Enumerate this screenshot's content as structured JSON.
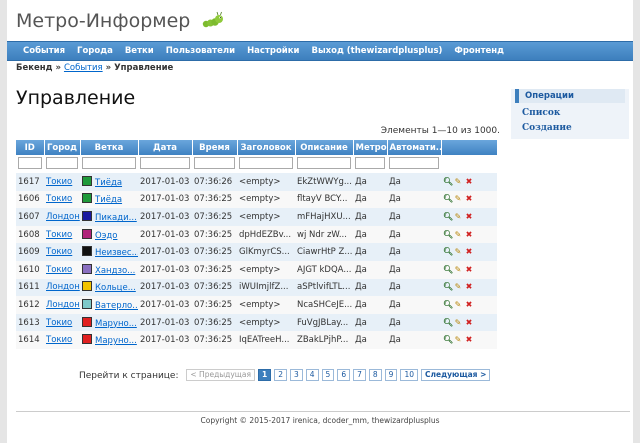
{
  "site": {
    "title": "Метро-Информер"
  },
  "menu": [
    "События",
    "Города",
    "Ветки",
    "Пользователи",
    "Настройки",
    "Выход (thewizardplusplus)",
    "Фронтенд"
  ],
  "breadcrumb": {
    "root": "Бекенд",
    "sep1": "»",
    "link": "События",
    "sep2": "»",
    "current": "Управление"
  },
  "page": {
    "heading": "Управление",
    "summary": "Элементы 1—10 из 1000."
  },
  "operations": {
    "title": "Операции",
    "list": "Список",
    "create": "Создание"
  },
  "table": {
    "headers": [
      "ID",
      "Город",
      "Ветка",
      "Дата",
      "Время",
      "Заголовок",
      "Описание",
      "Метро",
      "Автомати..."
    ],
    "rows": [
      {
        "id": "1617",
        "city": "Токио",
        "line": "Тиёда",
        "color": "#1f9a3a",
        "date": "2017-01-03",
        "time": "07:36:26",
        "title": "<empty>",
        "desc": "EkZtWWYg...",
        "metro": "Да",
        "auto": "Да"
      },
      {
        "id": "1606",
        "city": "Токио",
        "line": "Тиёда",
        "color": "#1f9a3a",
        "date": "2017-01-03",
        "time": "07:36:25",
        "title": "<empty>",
        "desc": "fltayV BCY...",
        "metro": "Да",
        "auto": "Да"
      },
      {
        "id": "1607",
        "city": "Лондон",
        "line": "Пикади...",
        "color": "#1a1aa0",
        "date": "2017-01-03",
        "time": "07:36:25",
        "title": "<empty>",
        "desc": "mFHajHXU...",
        "metro": "Да",
        "auto": "Да"
      },
      {
        "id": "1608",
        "city": "Токио",
        "line": "Оэдо",
        "color": "#b0237a",
        "date": "2017-01-03",
        "time": "07:36:25",
        "title": "dpHdEZBv...",
        "desc": "wj Ndr zW...",
        "metro": "Да",
        "auto": "Да"
      },
      {
        "id": "1609",
        "city": "Токио",
        "line": "Неизвес...",
        "color": "#111111",
        "date": "2017-01-03",
        "time": "07:36:25",
        "title": "GlKmyrCS...",
        "desc": "CiawrHtP Z...",
        "metro": "Да",
        "auto": "Да"
      },
      {
        "id": "1610",
        "city": "Токио",
        "line": "Хандзо...",
        "color": "#8a6fc0",
        "date": "2017-01-03",
        "time": "07:36:25",
        "title": "<empty>",
        "desc": "AJGT kDQA...",
        "metro": "Да",
        "auto": "Да"
      },
      {
        "id": "1611",
        "city": "Лондон",
        "line": "Кольце...",
        "color": "#f2c400",
        "date": "2017-01-03",
        "time": "07:36:25",
        "title": "iWUImjlfZ...",
        "desc": "aSPtlvifLTL...",
        "metro": "Да",
        "auto": "Да"
      },
      {
        "id": "1612",
        "city": "Лондон",
        "line": "Ватерло...",
        "color": "#7ec9c9",
        "date": "2017-01-03",
        "time": "07:36:25",
        "title": "<empty>",
        "desc": "NcaSHCeJE...",
        "metro": "Да",
        "auto": "Да"
      },
      {
        "id": "1613",
        "city": "Токио",
        "line": "Маруно...",
        "color": "#e02020",
        "date": "2017-01-03",
        "time": "07:36:25",
        "title": "<empty>",
        "desc": "FuVgJBLay...",
        "metro": "Да",
        "auto": "Да"
      },
      {
        "id": "1614",
        "city": "Токио",
        "line": "Маруно...",
        "color": "#e02020",
        "date": "2017-01-03",
        "time": "07:36:25",
        "title": "IqEATreeH...",
        "desc": "ZBakLPjhP...",
        "metro": "Да",
        "auto": "Да"
      }
    ]
  },
  "pager": {
    "label": "Перейти к странице:",
    "prev": "< Предыдущая",
    "pages": [
      "1",
      "2",
      "3",
      "4",
      "5",
      "6",
      "7",
      "8",
      "9",
      "10"
    ],
    "current": "1",
    "next": "Следующая >"
  },
  "footer": {
    "text": "Copyright © 2015-2017 irenica, dcoder_mm, thewizardplusplus"
  },
  "colors": {
    "menu": "#3d7fbd",
    "link": "#0066cc",
    "row_alt": "#e7f0f8"
  }
}
